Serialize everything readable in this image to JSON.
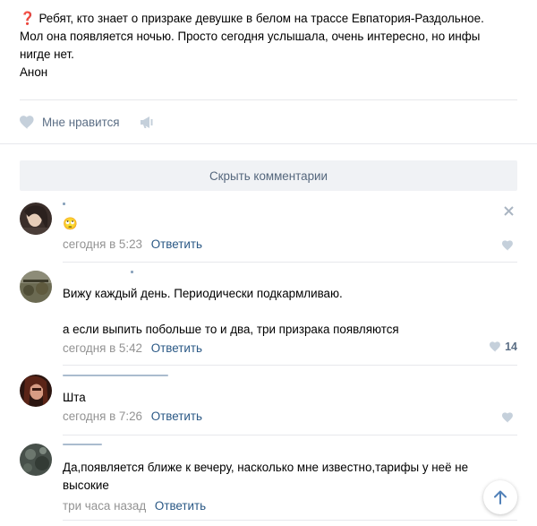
{
  "post": {
    "lines": [
      "Ребят, кто знает о призраке девушке в белом на трассе Евпатория-Раздольное.",
      "Мол она появляется ночью. Просто сегодня услышала, очень интересно, но инфы",
      "нигде нет.",
      "Анон"
    ]
  },
  "actions": {
    "like_label": "Мне нравится"
  },
  "hide_comments_label": "Скрыть комментарии",
  "comments": [
    {
      "text_lines": [
        "🙄"
      ],
      "time": "сегодня в 5:23",
      "reply_label": "Ответить",
      "likes": ""
    },
    {
      "text_lines": [
        "Вижу каждый день. Периодически подкармливаю.",
        "",
        "а если выпить побольше то и два, три призрака появляются"
      ],
      "time": "сегодня в 5:42",
      "reply_label": "Ответить",
      "likes": "14"
    },
    {
      "text_lines": [
        "Шта"
      ],
      "time": "сегодня в 7:26",
      "reply_label": "Ответить",
      "likes": ""
    },
    {
      "text_lines": [
        "Да,появляется ближе к вечеру, насколько мне известно,тарифы у неё не",
        "высокие"
      ],
      "time": "три часа назад",
      "reply_label": "Ответить",
      "likes": ""
    }
  ],
  "icons": {
    "question": "question-mark-icon",
    "heart": "heart-icon",
    "share": "megaphone-icon",
    "close": "close-icon",
    "scroll_up": "arrow-up-icon"
  },
  "colors": {
    "link": "#2a5885",
    "meta": "#939393",
    "button_bg": "#f0f2f5",
    "icon": "#b7c2cf",
    "question": "#d8262b"
  }
}
